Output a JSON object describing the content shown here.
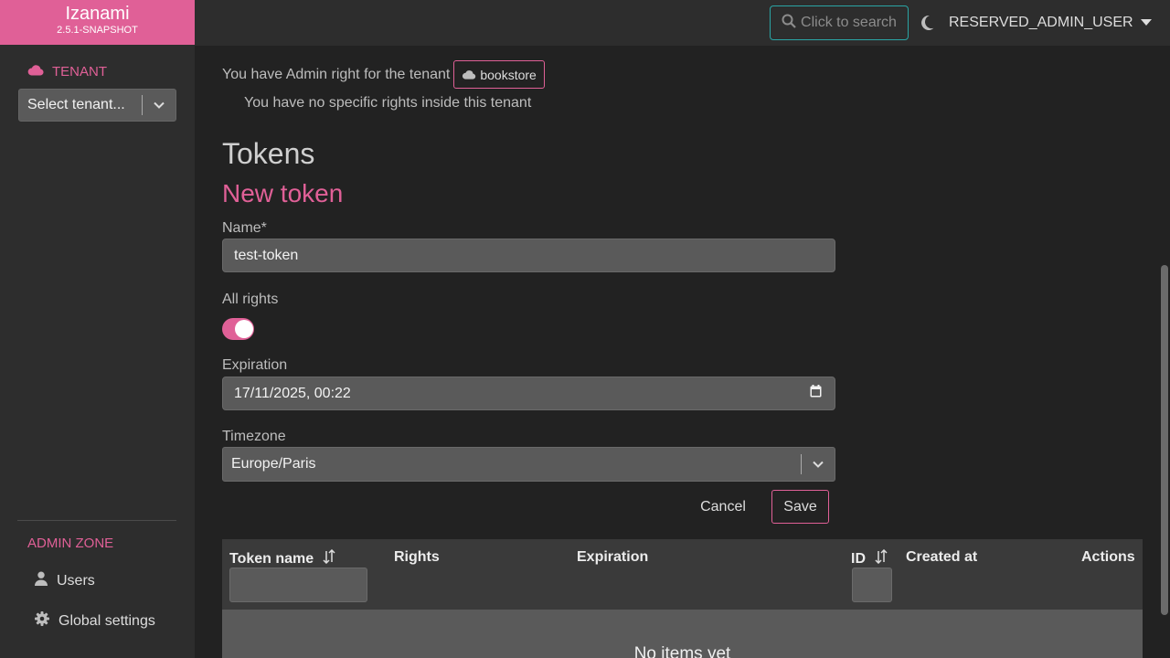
{
  "app": {
    "name": "Izanami",
    "version": "2.5.1-SNAPSHOT"
  },
  "sidebar": {
    "tenant_label": "TENANT",
    "tenant_select_placeholder": "Select tenant...",
    "admin_zone_label": "ADMIN ZONE",
    "links": {
      "users": "Users",
      "global_settings": "Global settings"
    }
  },
  "topbar": {
    "search_label": "Click to search",
    "user": "RESERVED_ADMIN_USER"
  },
  "rights": {
    "admin_text": "You have Admin right for the tenant",
    "tenant_name": "bookstore",
    "no_rights_text": "You have no specific rights inside this tenant"
  },
  "page": {
    "title": "Tokens",
    "form_title": "New token"
  },
  "form": {
    "name_label": "Name*",
    "name_value": "test-token",
    "all_rights_label": "All rights",
    "all_rights_enabled": true,
    "expiration_label": "Expiration",
    "expiration_value": "17/11/2025, 00:22",
    "timezone_label": "Timezone",
    "timezone_value": "Europe/Paris",
    "cancel_label": "Cancel",
    "save_label": "Save"
  },
  "table": {
    "columns": [
      "Token name",
      "Rights",
      "Expiration",
      "ID",
      "Created at",
      "Actions"
    ],
    "empty_text": "No items yet"
  },
  "colors": {
    "accent": "#e06097",
    "search_border": "#2aa5a5",
    "sidebar_bg": "#2d2d2d",
    "main_bg": "#222222"
  }
}
